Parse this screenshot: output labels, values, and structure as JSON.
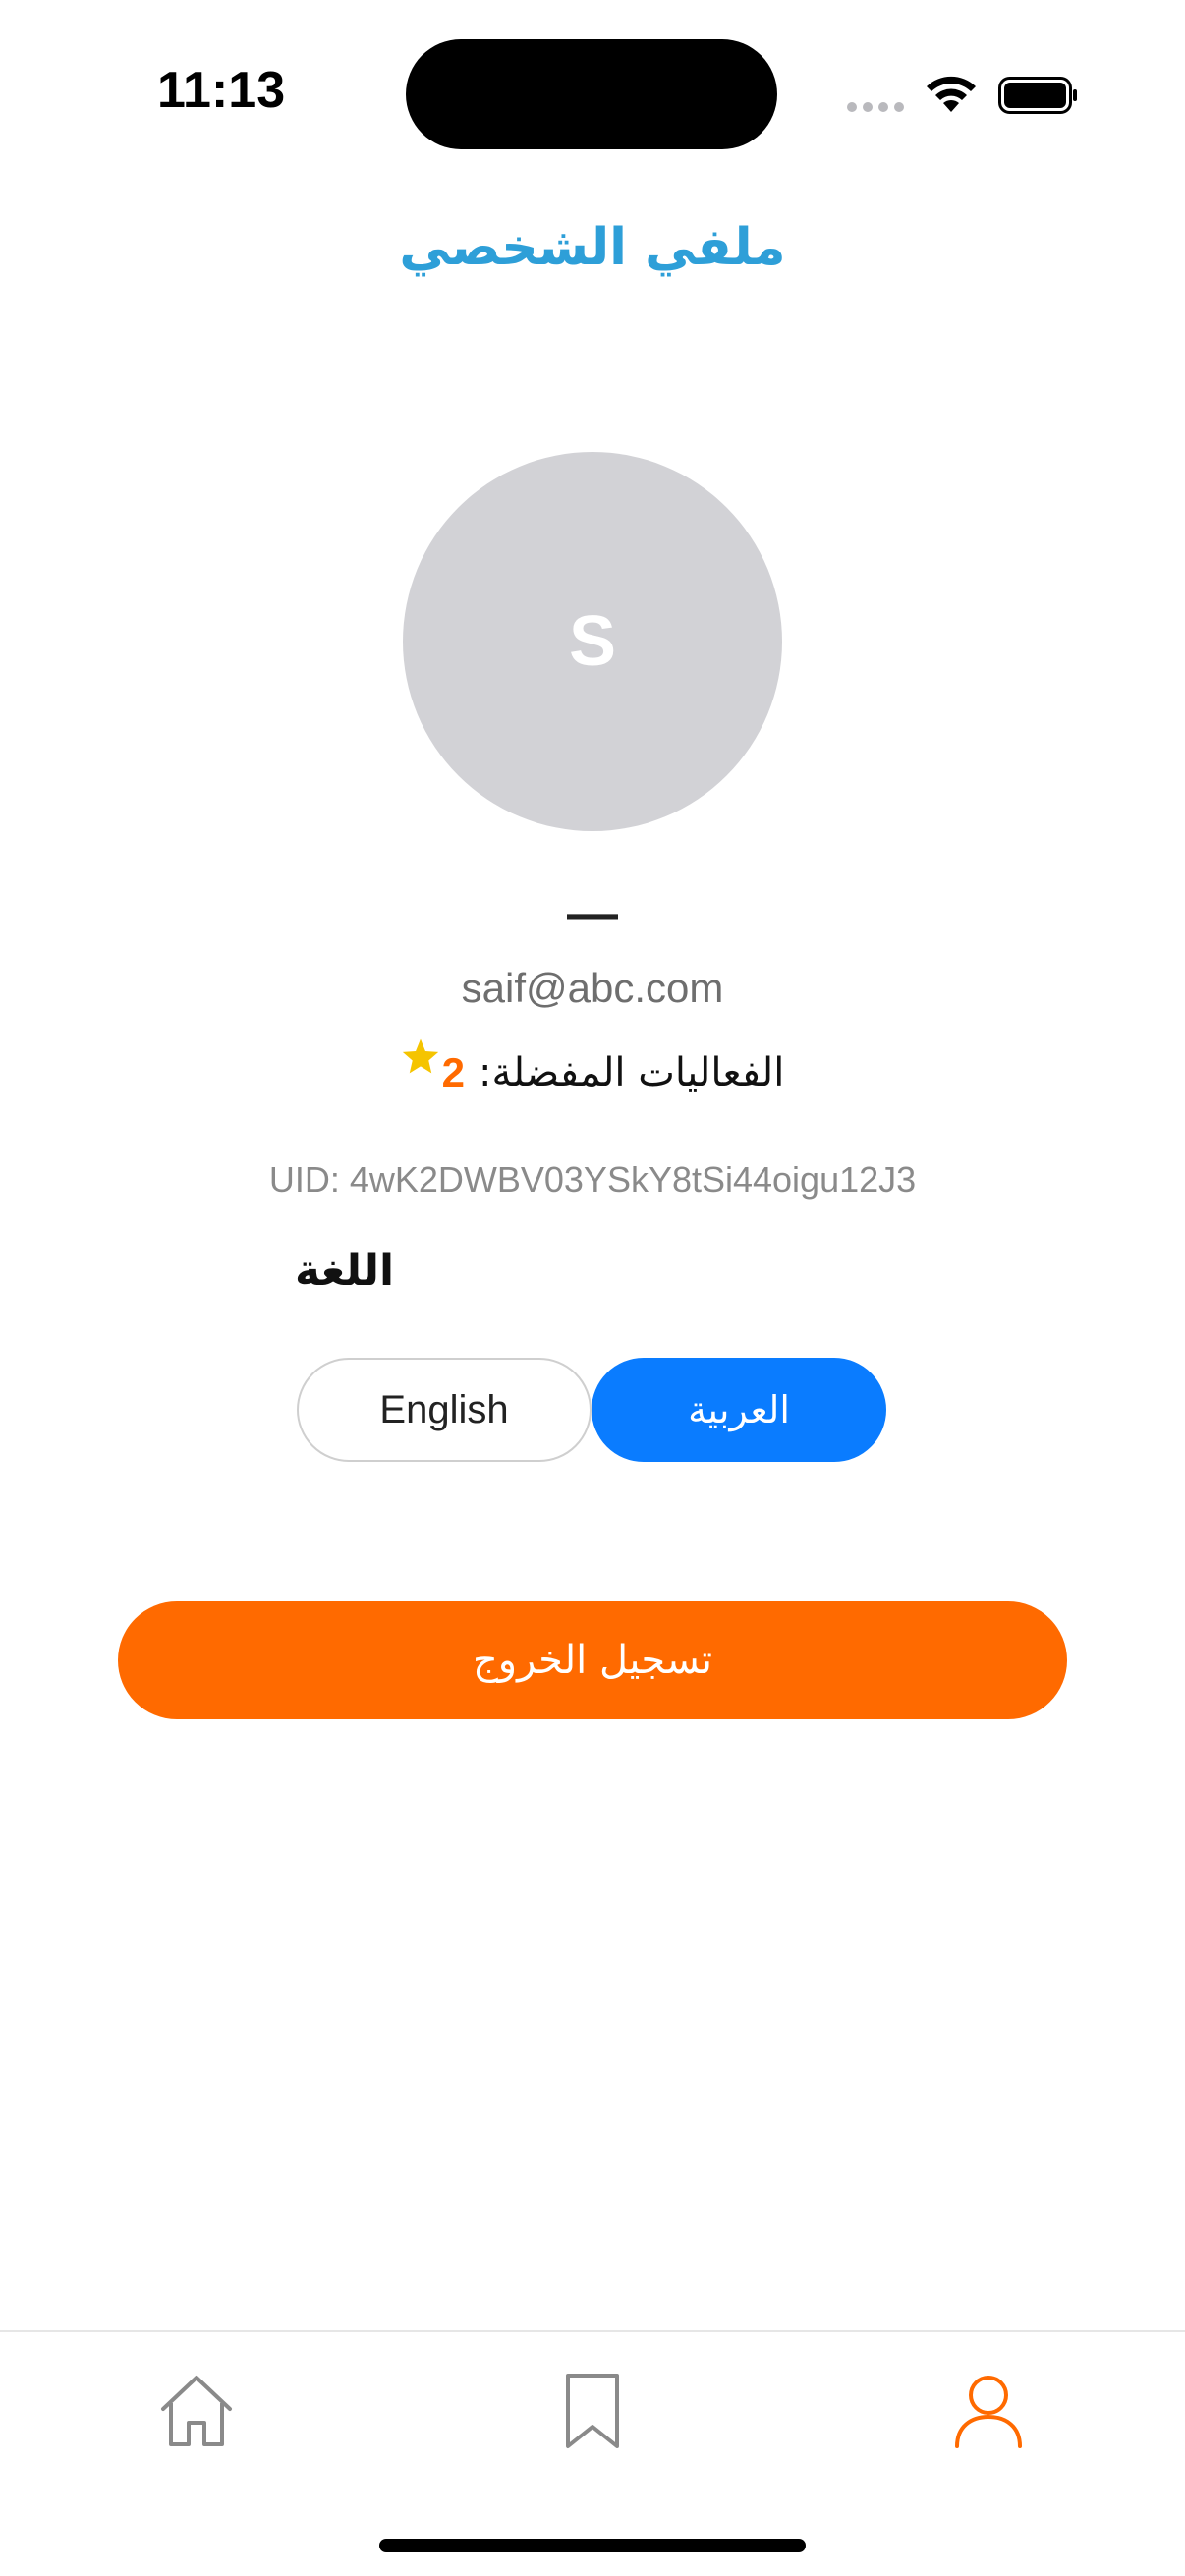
{
  "status_bar": {
    "time": "11:13"
  },
  "header": {
    "title": "ملفي الشخصي",
    "title_color": "#2e9fd8"
  },
  "profile": {
    "avatar_initial": "S",
    "name": "—",
    "email": "saif@abc.com",
    "favorites_label": "الفعاليات المفضلة:",
    "favorites_count": "2",
    "uid": "UID: 4wK2DWBV03YSkY8tSi44oigu12J3"
  },
  "language": {
    "title": "اللغة",
    "options": [
      "English",
      "العربية"
    ],
    "selected": "العربية",
    "selected_color": "#0a7cff"
  },
  "logout": {
    "label": "تسجيل الخروج",
    "color": "#ff6a00"
  },
  "tab_bar": {
    "tabs": [
      {
        "icon": "home-icon"
      },
      {
        "icon": "bookmark-icon"
      },
      {
        "icon": "profile-icon",
        "active": true
      }
    ],
    "active_color": "#ff6a00"
  }
}
